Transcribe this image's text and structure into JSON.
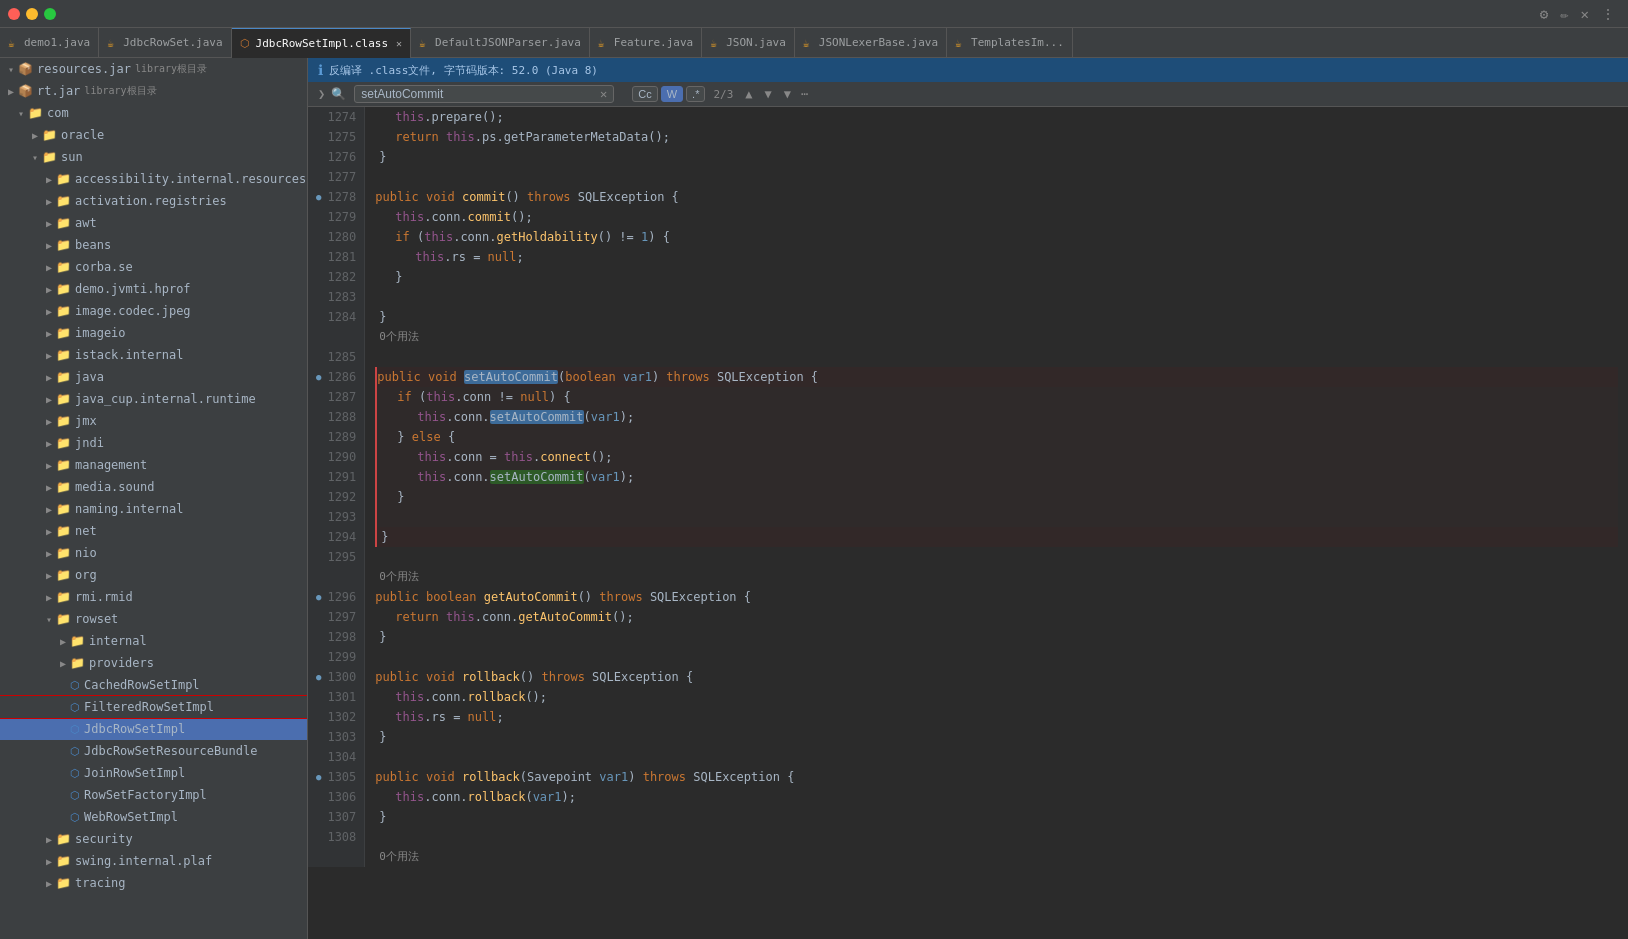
{
  "window": {
    "controls": [
      "close",
      "minimize",
      "maximize"
    ]
  },
  "tabs": [
    {
      "id": "tab1",
      "label": "demo1.java",
      "type": "java",
      "active": false,
      "closable": false
    },
    {
      "id": "tab2",
      "label": "JdbcRowSet.java",
      "type": "java",
      "active": false,
      "closable": false
    },
    {
      "id": "tab3",
      "label": "JdbcRowSetImpl.class",
      "type": "class",
      "active": true,
      "closable": true
    },
    {
      "id": "tab4",
      "label": "DefaultJSONParser.java",
      "type": "java",
      "active": false,
      "closable": false
    },
    {
      "id": "tab5",
      "label": "Feature.java",
      "type": "java",
      "active": false,
      "closable": false
    },
    {
      "id": "tab6",
      "label": "JSON.java",
      "type": "java",
      "active": false,
      "closable": false
    },
    {
      "id": "tab7",
      "label": "JSONLexerBase.java",
      "type": "java",
      "active": false,
      "closable": false
    },
    {
      "id": "tab8",
      "label": "TemplatesIm...",
      "type": "java",
      "active": false,
      "closable": false
    }
  ],
  "info_bar": {
    "message": "反编译 .class文件, 字节码版本: 52.0 (Java 8)"
  },
  "search": {
    "query": "setAutoCommit",
    "count": "2/3",
    "options": [
      "Cc",
      "W",
      ".*"
    ]
  },
  "sidebar": {
    "root_items": [
      {
        "id": "resources_jar",
        "label": "resources.jar",
        "sublabel": "library根目录",
        "type": "root",
        "expanded": true,
        "indent": 0
      },
      {
        "id": "rt_jar",
        "label": "rt.jar",
        "sublabel": "library根目录",
        "type": "root",
        "expanded": false,
        "indent": 0
      }
    ],
    "tree": [
      {
        "id": "com",
        "label": "com",
        "type": "folder",
        "expanded": true,
        "indent": 1
      },
      {
        "id": "oracle",
        "label": "oracle",
        "type": "folder",
        "expanded": false,
        "indent": 2
      },
      {
        "id": "sun",
        "label": "sun",
        "type": "folder",
        "expanded": true,
        "indent": 2
      },
      {
        "id": "accessibility_internal_resources",
        "label": "accessibility.internal.resources",
        "type": "folder",
        "expanded": false,
        "indent": 3
      },
      {
        "id": "activation_registries",
        "label": "activation.registries",
        "type": "folder",
        "expanded": false,
        "indent": 3
      },
      {
        "id": "awt",
        "label": "awt",
        "type": "folder",
        "expanded": false,
        "indent": 3
      },
      {
        "id": "beans",
        "label": "beans",
        "type": "folder",
        "expanded": false,
        "indent": 3
      },
      {
        "id": "corba_se",
        "label": "corba.se",
        "type": "folder",
        "expanded": false,
        "indent": 3
      },
      {
        "id": "demo_jvmti_hprof",
        "label": "demo.jvmti.hprof",
        "type": "folder",
        "expanded": false,
        "indent": 3
      },
      {
        "id": "image_codec_jpeg",
        "label": "image.codec.jpeg",
        "type": "folder",
        "expanded": false,
        "indent": 3
      },
      {
        "id": "imageio",
        "label": "imageio",
        "type": "folder",
        "expanded": false,
        "indent": 3
      },
      {
        "id": "istack_internal",
        "label": "istack.internal",
        "type": "folder",
        "expanded": false,
        "indent": 3
      },
      {
        "id": "java",
        "label": "java",
        "type": "folder",
        "expanded": false,
        "indent": 3
      },
      {
        "id": "java_cup_internal_runtime",
        "label": "java_cup.internal.runtime",
        "type": "folder",
        "expanded": false,
        "indent": 3
      },
      {
        "id": "jmx",
        "label": "jmx",
        "type": "folder",
        "expanded": false,
        "indent": 3
      },
      {
        "id": "jndi",
        "label": "jndi",
        "type": "folder",
        "expanded": false,
        "indent": 3
      },
      {
        "id": "management",
        "label": "management",
        "type": "folder",
        "expanded": false,
        "indent": 3
      },
      {
        "id": "media_sound",
        "label": "media.sound",
        "type": "folder",
        "expanded": false,
        "indent": 3
      },
      {
        "id": "naming_internal",
        "label": "naming.internal",
        "type": "folder",
        "expanded": false,
        "indent": 3
      },
      {
        "id": "net",
        "label": "net",
        "type": "folder",
        "expanded": false,
        "indent": 3
      },
      {
        "id": "nio",
        "label": "nio",
        "type": "folder",
        "expanded": false,
        "indent": 3
      },
      {
        "id": "org",
        "label": "org",
        "type": "folder",
        "expanded": false,
        "indent": 3
      },
      {
        "id": "rmi_rmid",
        "label": "rmi.rmid",
        "type": "folder",
        "expanded": false,
        "indent": 3
      },
      {
        "id": "rowset",
        "label": "rowset",
        "type": "folder",
        "expanded": true,
        "indent": 3
      },
      {
        "id": "rowset_internal",
        "label": "internal",
        "type": "folder",
        "expanded": false,
        "indent": 4
      },
      {
        "id": "rowset_providers",
        "label": "providers",
        "type": "folder",
        "expanded": false,
        "indent": 4
      },
      {
        "id": "CachedRowSetImpl",
        "label": "CachedRowSetImpl",
        "type": "class_file",
        "expanded": false,
        "indent": 4
      },
      {
        "id": "FilteredRowSetImpl",
        "label": "FilteredRowSetImpl",
        "type": "class_file",
        "expanded": false,
        "indent": 4,
        "highlighted": true
      },
      {
        "id": "JdbcRowSetImpl",
        "label": "JdbcRowSetImpl",
        "type": "class_file",
        "expanded": false,
        "indent": 4,
        "selected": true
      },
      {
        "id": "JdbcRowSetResourceBundle",
        "label": "JdbcRowSetResourceBundle",
        "type": "class_file",
        "expanded": false,
        "indent": 4
      },
      {
        "id": "JoinRowSetImpl",
        "label": "JoinRowSetImpl",
        "type": "class_file",
        "expanded": false,
        "indent": 4
      },
      {
        "id": "RowSetFactoryImpl",
        "label": "RowSetFactoryImpl",
        "type": "class_file",
        "expanded": false,
        "indent": 4
      },
      {
        "id": "WebRowSetImpl",
        "label": "WebRowSetImpl",
        "type": "class_file",
        "expanded": false,
        "indent": 4
      },
      {
        "id": "security",
        "label": "security",
        "type": "folder",
        "expanded": false,
        "indent": 3
      },
      {
        "id": "swing_internal_plaf",
        "label": "swing.internal.plaf",
        "type": "folder",
        "expanded": false,
        "indent": 3
      },
      {
        "id": "tracing",
        "label": "tracing",
        "type": "folder",
        "expanded": false,
        "indent": 3
      }
    ]
  },
  "code": {
    "lines": [
      {
        "num": 1274,
        "content": "    this.prepare();"
      },
      {
        "num": 1275,
        "content": "    return this.ps.getParameterMetaData();"
      },
      {
        "num": 1276,
        "content": "}"
      },
      {
        "num": 1277,
        "content": ""
      },
      {
        "num": 1278,
        "content": "public void commit() throws SQLException {",
        "gutter": "🔵"
      },
      {
        "num": 1279,
        "content": "    this.conn.commit();"
      },
      {
        "num": 1280,
        "content": "    if (this.conn.getHoldability() != 1) {"
      },
      {
        "num": 1281,
        "content": "        this.rs = null;"
      },
      {
        "num": 1282,
        "content": "    }"
      },
      {
        "num": 1283,
        "content": ""
      },
      {
        "num": 1284,
        "content": "}"
      },
      {
        "num": 1285,
        "content": ""
      },
      {
        "num": 1285,
        "content": "0个用法",
        "usages": true,
        "in_box": false
      },
      {
        "num": 1286,
        "content": "public void setAutoCommit(boolean var1) throws SQLException {",
        "gutter": "🔵",
        "in_box": true
      },
      {
        "num": 1287,
        "content": "    if (this.conn != null) {",
        "in_box": true
      },
      {
        "num": 1288,
        "content": "        this.conn.setAutoCommit(var1);",
        "in_box": true,
        "highlight_method": true
      },
      {
        "num": 1289,
        "content": "    } else {",
        "in_box": true
      },
      {
        "num": 1290,
        "content": "        this.conn = this.connect();",
        "in_box": true
      },
      {
        "num": 1291,
        "content": "        this.conn.setAutoCommit(var1);",
        "in_box": true,
        "highlight_method2": true
      },
      {
        "num": 1292,
        "content": "    }",
        "in_box": true
      },
      {
        "num": 1293,
        "content": "",
        "in_box": true
      },
      {
        "num": 1294,
        "content": "}",
        "in_box": true
      },
      {
        "num": 1295,
        "content": "",
        "in_box": false
      },
      {
        "num": 1295,
        "content": "0个用法",
        "usages": true,
        "in_box": false
      },
      {
        "num": 1296,
        "content": "public boolean getAutoCommit() throws SQLException {",
        "gutter": "🔵"
      },
      {
        "num": 1297,
        "content": "    return this.conn.getAutoCommit();"
      },
      {
        "num": 1298,
        "content": "}"
      },
      {
        "num": 1299,
        "content": ""
      },
      {
        "num": 1300,
        "content": "public void rollback() throws SQLException {",
        "gutter": "🔵"
      },
      {
        "num": 1301,
        "content": "    this.conn.rollback();"
      },
      {
        "num": 1302,
        "content": "    this.rs = null;"
      },
      {
        "num": 1303,
        "content": "}"
      },
      {
        "num": 1304,
        "content": ""
      },
      {
        "num": 1305,
        "content": "public void rollback(Savepoint var1) throws SQLException {",
        "gutter": "🔵"
      },
      {
        "num": 1306,
        "content": "    this.conn.rollback(var1);"
      },
      {
        "num": 1307,
        "content": "}"
      },
      {
        "num": 1308,
        "content": ""
      },
      {
        "num": 1308,
        "content": "0个用法",
        "usages": true
      }
    ]
  }
}
